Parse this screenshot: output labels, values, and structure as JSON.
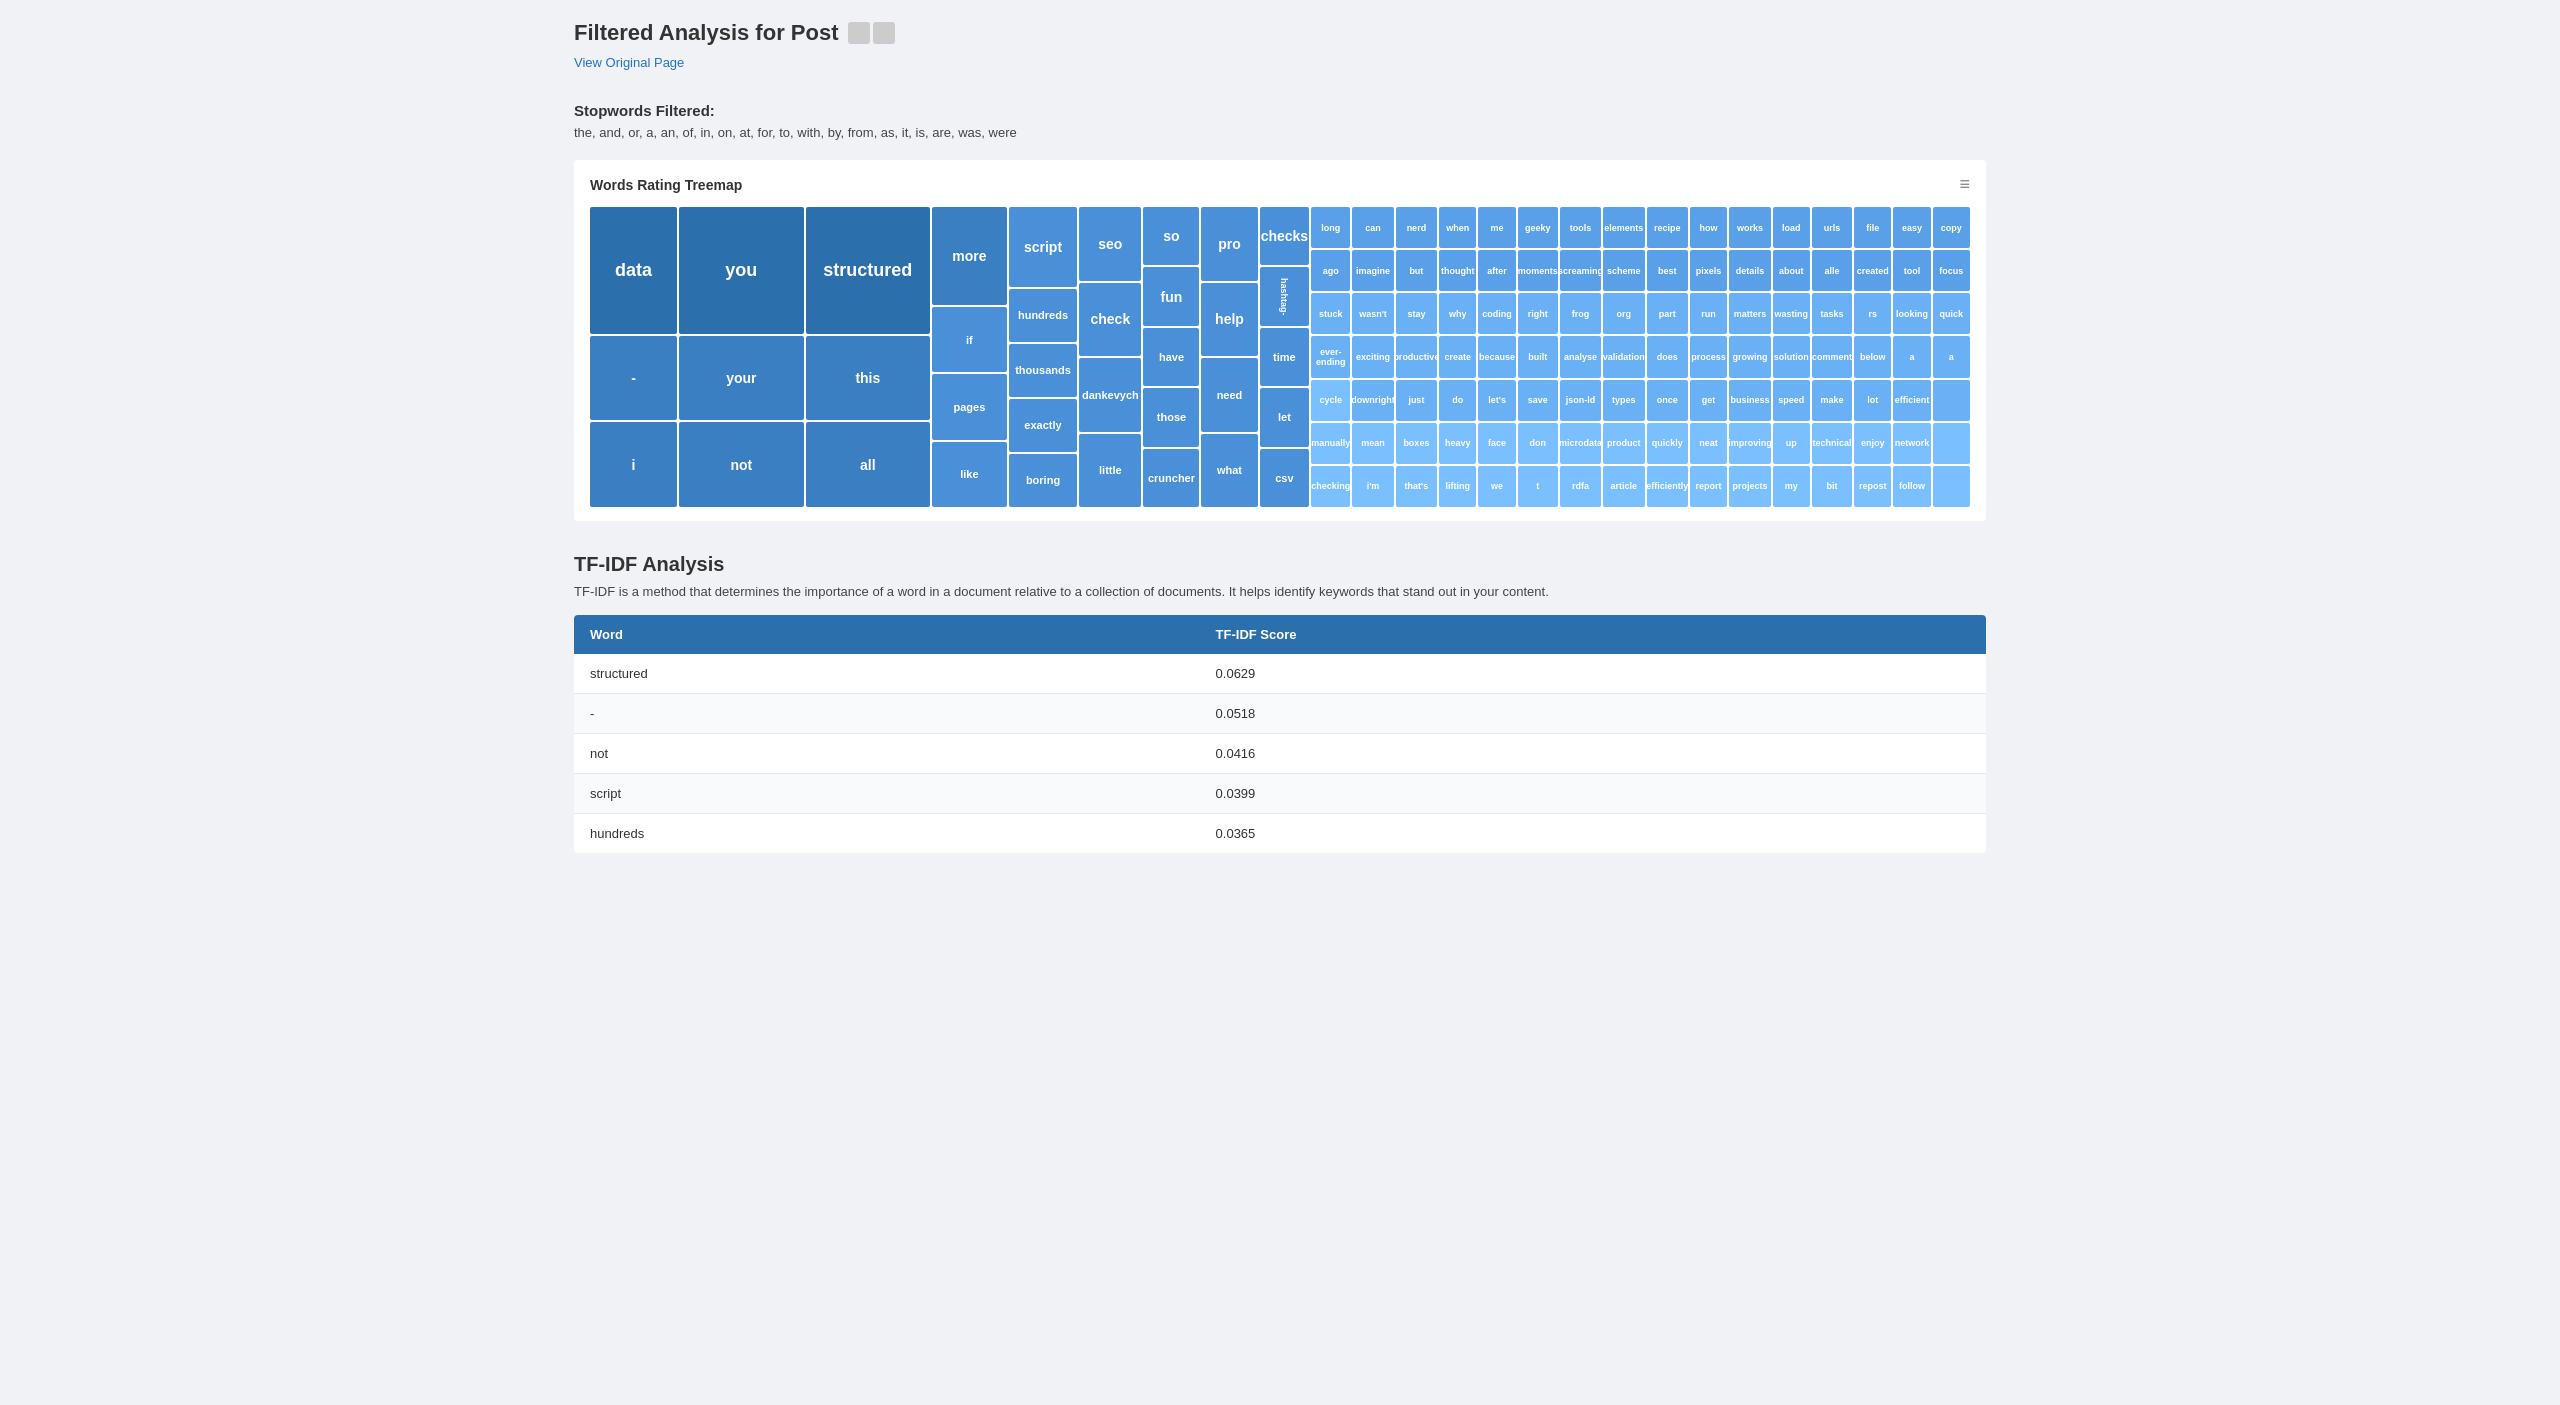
{
  "page": {
    "title": "Filtered Analysis for Post",
    "view_link": "View Original Page"
  },
  "stopwords": {
    "label": "Stopwords Filtered:",
    "words": "the, and, or, a, an, of, in, on, at, for, to, with, by, from, as, it, is, are, was, were"
  },
  "treemap": {
    "title": "Words Rating Treemap",
    "menu_icon": "≡",
    "cells": [
      {
        "word": "data",
        "size": 9,
        "shade": "shade-1"
      },
      {
        "word": "you",
        "size": 7,
        "shade": "shade-1"
      },
      {
        "word": "structured",
        "size": 7,
        "shade": "shade-1"
      },
      {
        "word": "more",
        "size": 5,
        "shade": "shade-2"
      },
      {
        "word": "-",
        "size": 5,
        "shade": "shade-2"
      },
      {
        "word": "your",
        "size": 5,
        "shade": "shade-2"
      },
      {
        "word": "this",
        "size": 5,
        "shade": "shade-2"
      },
      {
        "word": "i",
        "size": 4,
        "shade": "shade-2"
      },
      {
        "word": "not",
        "size": 4,
        "shade": "shade-2"
      },
      {
        "word": "all",
        "size": 4,
        "shade": "shade-2"
      },
      {
        "word": "script",
        "size": 4,
        "shade": "shade-3"
      },
      {
        "word": "hundreds",
        "size": 3,
        "shade": "shade-3"
      },
      {
        "word": "if",
        "size": 3,
        "shade": "shade-3"
      },
      {
        "word": "thousands",
        "size": 3,
        "shade": "shade-3"
      },
      {
        "word": "exactly",
        "size": 3,
        "shade": "shade-3"
      },
      {
        "word": "pages",
        "size": 3,
        "shade": "shade-3"
      },
      {
        "word": "like",
        "size": 3,
        "shade": "shade-3"
      },
      {
        "word": "boring",
        "size": 3,
        "shade": "shade-3"
      },
      {
        "word": "seo",
        "size": 3,
        "shade": "shade-3"
      },
      {
        "word": "check",
        "size": 3,
        "shade": "shade-3"
      },
      {
        "word": "dankevych",
        "size": 3,
        "shade": "shade-3"
      },
      {
        "word": "so",
        "size": 3,
        "shade": "shade-3"
      },
      {
        "word": "fun",
        "size": 3,
        "shade": "shade-3"
      },
      {
        "word": "little",
        "size": 3,
        "shade": "shade-3"
      },
      {
        "word": "pro",
        "size": 3,
        "shade": "shade-3"
      },
      {
        "word": "help",
        "size": 3,
        "shade": "shade-3"
      },
      {
        "word": "those",
        "size": 3,
        "shade": "shade-3"
      },
      {
        "word": "cruncher",
        "size": 3,
        "shade": "shade-3"
      },
      {
        "word": "checks",
        "size": 3,
        "shade": "shade-3"
      },
      {
        "word": "have",
        "size": 3,
        "shade": "shade-3"
      },
      {
        "word": "need",
        "size": 3,
        "shade": "shade-3"
      },
      {
        "word": "what",
        "size": 3,
        "shade": "shade-3"
      },
      {
        "word": "time",
        "size": 3,
        "shade": "shade-3"
      },
      {
        "word": "let",
        "size": 3,
        "shade": "shade-3"
      },
      {
        "word": "csv",
        "size": 3,
        "shade": "shade-3"
      },
      {
        "word": "hashtag-",
        "size": 2,
        "shade": "shade-3"
      },
      {
        "word": "long",
        "size": 2,
        "shade": "shade-4"
      },
      {
        "word": "can",
        "size": 2,
        "shade": "shade-4"
      },
      {
        "word": "nerd",
        "size": 2,
        "shade": "shade-4"
      },
      {
        "word": "when",
        "size": 2,
        "shade": "shade-4"
      },
      {
        "word": "me",
        "size": 2,
        "shade": "shade-4"
      },
      {
        "word": "geeky",
        "size": 2,
        "shade": "shade-4"
      },
      {
        "word": "tools",
        "size": 2,
        "shade": "shade-4"
      },
      {
        "word": "elements",
        "size": 2,
        "shade": "shade-4"
      },
      {
        "word": "recipe",
        "size": 2,
        "shade": "shade-4"
      },
      {
        "word": "how",
        "size": 2,
        "shade": "shade-4"
      },
      {
        "word": "works",
        "size": 2,
        "shade": "shade-4"
      },
      {
        "word": "load",
        "size": 2,
        "shade": "shade-4"
      },
      {
        "word": "urls",
        "size": 2,
        "shade": "shade-4"
      },
      {
        "word": "file",
        "size": 2,
        "shade": "shade-4"
      },
      {
        "word": "easy",
        "size": 2,
        "shade": "shade-4"
      },
      {
        "word": "copy",
        "size": 2,
        "shade": "shade-4"
      },
      {
        "word": "ago",
        "size": 1,
        "shade": "shade-5"
      },
      {
        "word": "imagine",
        "size": 1,
        "shade": "shade-5"
      },
      {
        "word": "but",
        "size": 1,
        "shade": "shade-5"
      },
      {
        "word": "thought",
        "size": 1,
        "shade": "shade-5"
      },
      {
        "word": "after",
        "size": 1,
        "shade": "shade-5"
      },
      {
        "word": "moments",
        "size": 1,
        "shade": "shade-5"
      },
      {
        "word": "screaming",
        "size": 1,
        "shade": "shade-5"
      },
      {
        "word": "scheme",
        "size": 1,
        "shade": "shade-5"
      },
      {
        "word": "best",
        "size": 1,
        "shade": "shade-5"
      },
      {
        "word": "pixels",
        "size": 1,
        "shade": "shade-5"
      },
      {
        "word": "details",
        "size": 1,
        "shade": "shade-5"
      },
      {
        "word": "about",
        "size": 1,
        "shade": "shade-5"
      },
      {
        "word": "alle",
        "size": 1,
        "shade": "shade-5"
      },
      {
        "word": "created",
        "size": 1,
        "shade": "shade-5"
      },
      {
        "word": "tool",
        "size": 1,
        "shade": "shade-5"
      },
      {
        "word": "focus",
        "size": 1,
        "shade": "shade-5"
      },
      {
        "word": "stuck",
        "size": 1,
        "shade": "shade-5"
      },
      {
        "word": "wasn't",
        "size": 1,
        "shade": "shade-5"
      },
      {
        "word": "stay",
        "size": 1,
        "shade": "shade-5"
      },
      {
        "word": "why",
        "size": 1,
        "shade": "shade-5"
      },
      {
        "word": "coding",
        "size": 1,
        "shade": "shade-5"
      },
      {
        "word": "right",
        "size": 1,
        "shade": "shade-5"
      },
      {
        "word": "frog",
        "size": 1,
        "shade": "shade-5"
      },
      {
        "word": "org",
        "size": 1,
        "shade": "shade-5"
      },
      {
        "word": "part",
        "size": 1,
        "shade": "shade-5"
      },
      {
        "word": "run",
        "size": 1,
        "shade": "shade-5"
      },
      {
        "word": "matters",
        "size": 1,
        "shade": "shade-5"
      },
      {
        "word": "wasting",
        "size": 1,
        "shade": "shade-5"
      },
      {
        "word": "tasks",
        "size": 1,
        "shade": "shade-5"
      },
      {
        "word": "rs",
        "size": 1,
        "shade": "shade-5"
      },
      {
        "word": "looking",
        "size": 1,
        "shade": "shade-5"
      },
      {
        "word": "quick",
        "size": 1,
        "shade": "shade-5"
      },
      {
        "word": "ever-ending",
        "size": 1,
        "shade": "shade-5"
      },
      {
        "word": "exciting",
        "size": 1,
        "shade": "shade-5"
      },
      {
        "word": "productive",
        "size": 1,
        "shade": "shade-5"
      },
      {
        "word": "create",
        "size": 1,
        "shade": "shade-5"
      },
      {
        "word": "because",
        "size": 1,
        "shade": "shade-5"
      },
      {
        "word": "built",
        "size": 1,
        "shade": "shade-5"
      },
      {
        "word": "analyse",
        "size": 1,
        "shade": "shade-5"
      },
      {
        "word": "validation",
        "size": 1,
        "shade": "shade-5"
      },
      {
        "word": "does",
        "size": 1,
        "shade": "shade-5"
      },
      {
        "word": "process",
        "size": 1,
        "shade": "shade-5"
      },
      {
        "word": "growing",
        "size": 1,
        "shade": "shade-5"
      },
      {
        "word": "solution",
        "size": 1,
        "shade": "shade-5"
      },
      {
        "word": "comment",
        "size": 1,
        "shade": "shade-5"
      },
      {
        "word": "below",
        "size": 1,
        "shade": "shade-5"
      },
      {
        "word": "a",
        "size": 1,
        "shade": "shade-5"
      },
      {
        "word": "cycle",
        "size": 1,
        "shade": "shade-5"
      },
      {
        "word": "downright",
        "size": 1,
        "shade": "shade-5"
      },
      {
        "word": "just",
        "size": 1,
        "shade": "shade-5"
      },
      {
        "word": "do",
        "size": 1,
        "shade": "shade-5"
      },
      {
        "word": "let's",
        "size": 1,
        "shade": "shade-5"
      },
      {
        "word": "save",
        "size": 1,
        "shade": "shade-5"
      },
      {
        "word": "json-ld",
        "size": 1,
        "shade": "shade-5"
      },
      {
        "word": "types",
        "size": 1,
        "shade": "shade-5"
      },
      {
        "word": "once",
        "size": 1,
        "shade": "shade-5"
      },
      {
        "word": "get",
        "size": 1,
        "shade": "shade-5"
      },
      {
        "word": "business",
        "size": 1,
        "shade": "shade-5"
      },
      {
        "word": "speed",
        "size": 1,
        "shade": "shade-5"
      },
      {
        "word": "make",
        "size": 1,
        "shade": "shade-5"
      },
      {
        "word": "lot",
        "size": 1,
        "shade": "shade-5"
      },
      {
        "word": "efficient",
        "size": 1,
        "shade": "shade-5"
      },
      {
        "word": "manually",
        "size": 1,
        "shade": "shade-6"
      },
      {
        "word": "mean",
        "size": 1,
        "shade": "shade-6"
      },
      {
        "word": "boxes",
        "size": 1,
        "shade": "shade-6"
      },
      {
        "word": "heavy",
        "size": 1,
        "shade": "shade-6"
      },
      {
        "word": "face",
        "size": 1,
        "shade": "shade-6"
      },
      {
        "word": "don",
        "size": 1,
        "shade": "shade-6"
      },
      {
        "word": "microdata",
        "size": 1,
        "shade": "shade-6"
      },
      {
        "word": "product",
        "size": 1,
        "shade": "shade-6"
      },
      {
        "word": "quickly",
        "size": 1,
        "shade": "shade-6"
      },
      {
        "word": "neat",
        "size": 1,
        "shade": "shade-6"
      },
      {
        "word": "improving",
        "size": 1,
        "shade": "shade-6"
      },
      {
        "word": "up",
        "size": 1,
        "shade": "shade-6"
      },
      {
        "word": "technical",
        "size": 1,
        "shade": "shade-6"
      },
      {
        "word": "enjoy",
        "size": 1,
        "shade": "shade-6"
      },
      {
        "word": "network",
        "size": 1,
        "shade": "shade-6"
      },
      {
        "word": "checking",
        "size": 1,
        "shade": "shade-6"
      },
      {
        "word": "i'm",
        "size": 1,
        "shade": "shade-6"
      },
      {
        "word": "that's",
        "size": 1,
        "shade": "shade-6"
      },
      {
        "word": "lifting",
        "size": 1,
        "shade": "shade-6"
      },
      {
        "word": "we",
        "size": 1,
        "shade": "shade-6"
      },
      {
        "word": "t",
        "size": 1,
        "shade": "shade-6"
      },
      {
        "word": "rdfa",
        "size": 1,
        "shade": "shade-6"
      },
      {
        "word": "article",
        "size": 1,
        "shade": "shade-6"
      },
      {
        "word": "efficiently",
        "size": 1,
        "shade": "shade-6"
      },
      {
        "word": "report",
        "size": 1,
        "shade": "shade-6"
      },
      {
        "word": "projects",
        "size": 1,
        "shade": "shade-6"
      },
      {
        "word": "my",
        "size": 1,
        "shade": "shade-6"
      },
      {
        "word": "bit",
        "size": 1,
        "shade": "shade-6"
      },
      {
        "word": "repost",
        "size": 1,
        "shade": "shade-6"
      },
      {
        "word": "follow",
        "size": 1,
        "shade": "shade-6"
      }
    ]
  },
  "tfidf": {
    "title": "TF-IDF Analysis",
    "description": "TF-IDF is a method that determines the importance of a word in a document relative to a collection of documents. It helps identify keywords that stand out in your content.",
    "table": {
      "col_word": "Word",
      "col_score": "TF-IDF Score",
      "rows": [
        {
          "word": "structured",
          "score": "0.0629"
        },
        {
          "word": "-",
          "score": "0.0518"
        },
        {
          "word": "not",
          "score": "0.0416"
        },
        {
          "word": "script",
          "score": "0.0399"
        },
        {
          "word": "hundreds",
          "score": "0.0365"
        }
      ]
    }
  }
}
